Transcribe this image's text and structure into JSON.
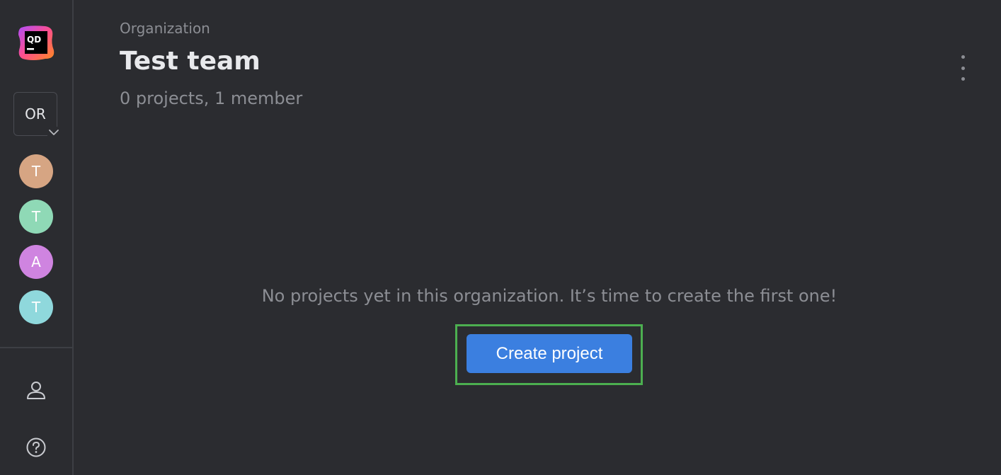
{
  "sidebar": {
    "logo_text": "QD",
    "org_switcher": "OR",
    "avatars": [
      {
        "letter": "T",
        "color": "#d6a583"
      },
      {
        "letter": "T",
        "color": "#8fd9b6"
      },
      {
        "letter": "A",
        "color": "#cf84e0"
      },
      {
        "letter": "T",
        "color": "#8fd8dc"
      }
    ],
    "icons": [
      "user-icon",
      "help-icon"
    ]
  },
  "header": {
    "eyebrow": "Organization",
    "title": "Test team",
    "subtitle": "0 projects, 1 member"
  },
  "empty_state": {
    "message": "No projects yet in this organization. It’s time to create the first one!",
    "button_label": "Create project"
  },
  "colors": {
    "background": "#2b2c30",
    "primary_button": "#3b7fe0",
    "highlight": "#4caf50"
  }
}
